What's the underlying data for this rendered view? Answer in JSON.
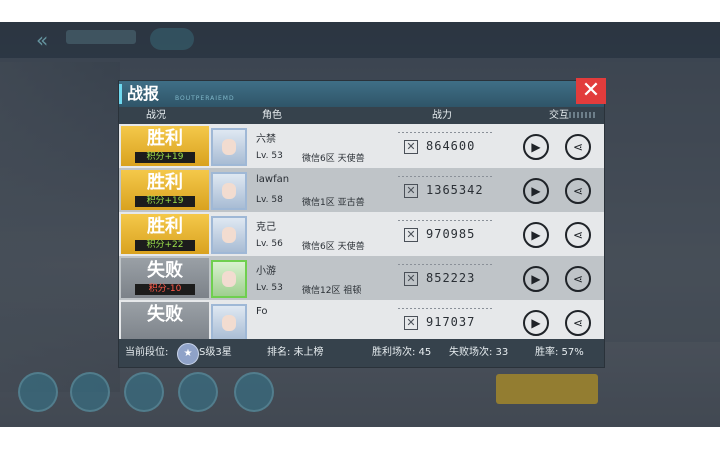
{
  "panel": {
    "title": "战报",
    "subtitle": "BOUTPERAIEMD",
    "close_label": "✕"
  },
  "headers": {
    "result": "战况",
    "role": "角色",
    "power": "战力",
    "interact": "交互"
  },
  "rows": [
    {
      "result": "胜利",
      "score": "积分+19",
      "outcome": "win",
      "name": "六禁",
      "level": "Lv. 53",
      "server": "微信6区 天使兽",
      "power": "864600"
    },
    {
      "result": "胜利",
      "score": "积分+19",
      "outcome": "win",
      "name": "lawfan",
      "level": "Lv. 58",
      "server": "微信1区 亚古兽",
      "power": "1365342"
    },
    {
      "result": "胜利",
      "score": "积分+22",
      "outcome": "win",
      "name": "克己",
      "level": "Lv. 56",
      "server": "微信6区 天使兽",
      "power": "970985"
    },
    {
      "result": "失败",
      "score": "积分-10",
      "outcome": "loss",
      "name": "小游",
      "level": "Lv. 53",
      "server": "微信12区 祖顿",
      "power": "852223"
    },
    {
      "result": "失败",
      "score": "",
      "outcome": "loss",
      "name": "Fo",
      "level": "",
      "server": "",
      "power": "917037"
    }
  ],
  "footer": {
    "rank_label": "当前段位:",
    "rank": "S级3星",
    "ranking": "排名: 未上榜",
    "wins": "胜利场次:  45",
    "losses": "失败场次:  33",
    "win_rate": "胜率: 57%"
  },
  "colors": {
    "win": "#f4c84a",
    "loss": "#9aa0a6",
    "close": "#e23c3c",
    "accent": "#6fd9ef"
  }
}
